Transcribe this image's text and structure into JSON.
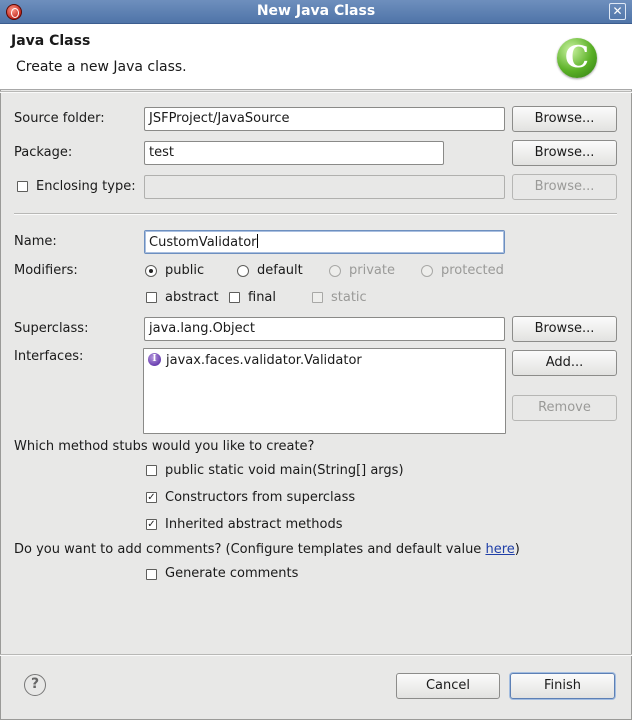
{
  "window": {
    "title": "New Java Class",
    "close_symbol": "✕",
    "app_icon": "eclipse-icon"
  },
  "banner": {
    "title": "Java Class",
    "description": "Create a new Java class.",
    "logo_letter": "C"
  },
  "form": {
    "source_folder": {
      "label": "Source folder:",
      "value": "JSFProject/JavaSource",
      "browse": "Browse..."
    },
    "package": {
      "label": "Package:",
      "value": "test",
      "browse": "Browse..."
    },
    "enclosing_type": {
      "label": "Enclosing type:",
      "checked": false,
      "value": "",
      "browse": "Browse..."
    },
    "name": {
      "label": "Name:",
      "value": "CustomValidator"
    },
    "modifiers": {
      "label": "Modifiers:",
      "access": [
        {
          "label": "public",
          "selected": true,
          "enabled": true
        },
        {
          "label": "default",
          "selected": false,
          "enabled": true
        },
        {
          "label": "private",
          "selected": false,
          "enabled": false
        },
        {
          "label": "protected",
          "selected": false,
          "enabled": false
        }
      ],
      "flags": [
        {
          "label": "abstract",
          "checked": false,
          "enabled": true
        },
        {
          "label": "final",
          "checked": false,
          "enabled": true
        },
        {
          "label": "static",
          "checked": false,
          "enabled": false
        }
      ]
    },
    "superclass": {
      "label": "Superclass:",
      "value": "java.lang.Object",
      "browse": "Browse..."
    },
    "interfaces": {
      "label": "Interfaces:",
      "items": [
        {
          "icon": "I",
          "name": "javax.faces.validator.Validator"
        }
      ],
      "add": "Add...",
      "remove": "Remove"
    },
    "stubs": {
      "question": "Which method stubs would you like to create?",
      "options": [
        {
          "label": "public static void main(String[] args)",
          "checked": false
        },
        {
          "label": "Constructors from superclass",
          "checked": true
        },
        {
          "label": "Inherited abstract methods",
          "checked": true
        }
      ]
    },
    "comments": {
      "question_prefix": "Do you want to add comments? (Configure templates and default value ",
      "link": "here",
      "question_suffix": ")",
      "option": {
        "label": "Generate comments",
        "checked": false
      }
    }
  },
  "footer": {
    "help_symbol": "?",
    "cancel": "Cancel",
    "finish": "Finish"
  },
  "check_symbol": "✓"
}
